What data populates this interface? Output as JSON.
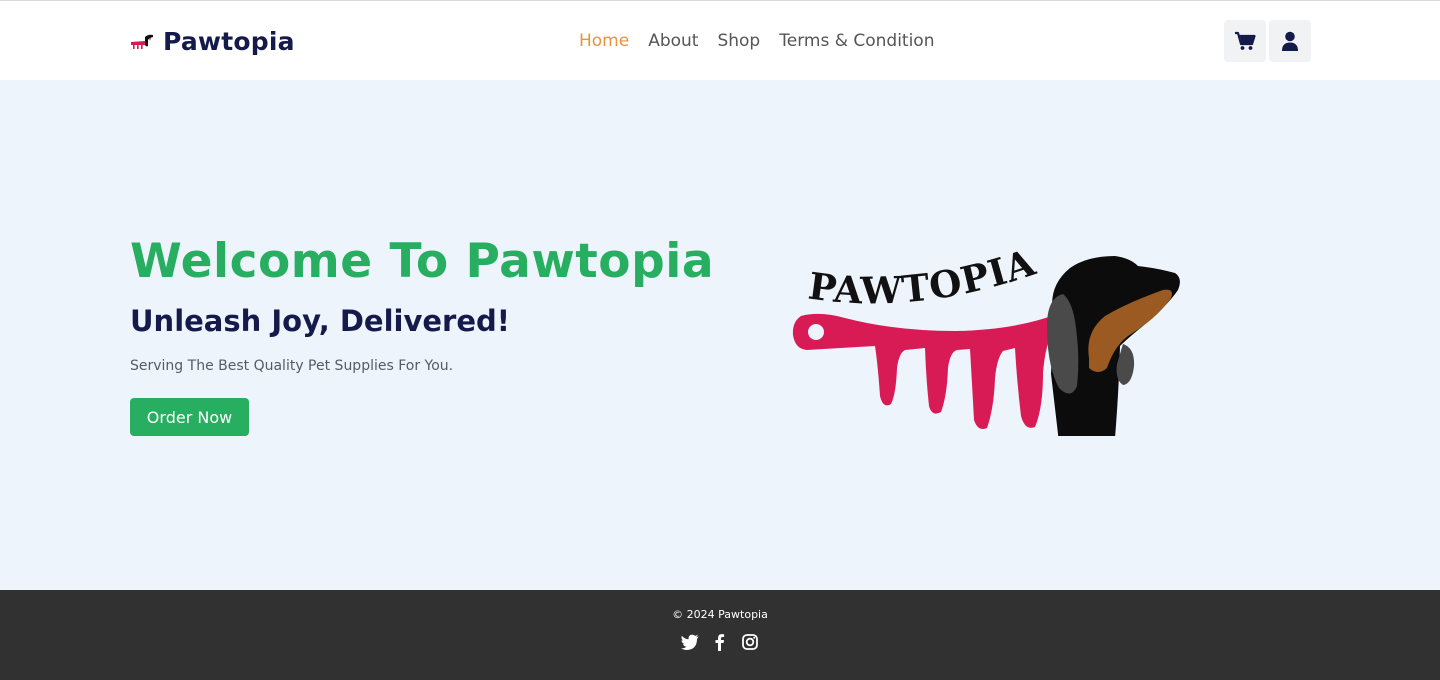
{
  "header": {
    "brand": "Pawtopia",
    "nav": [
      {
        "label": "Home",
        "active": true
      },
      {
        "label": "About",
        "active": false
      },
      {
        "label": "Shop",
        "active": false
      },
      {
        "label": "Terms & Condition",
        "active": false
      }
    ],
    "icons": [
      "cart-icon",
      "user-icon"
    ]
  },
  "hero": {
    "title": "Welcome To Pawtopia",
    "subtitle": "Unleash Joy, Delivered!",
    "text": "Serving The Best Quality Pet Supplies For You.",
    "cta": "Order Now",
    "logo_text": "PAWTOPIA"
  },
  "footer": {
    "copyright": "© 2024 Pawtopia",
    "social": [
      "twitter-icon",
      "facebook-icon",
      "instagram-icon"
    ]
  },
  "colors": {
    "accent_green": "#27ae60",
    "nav_active": "#e8943a",
    "brand_navy": "#141a4a",
    "hero_bg": "#eef4fc",
    "footer_bg": "#313131",
    "comb_pink": "#d81b55"
  }
}
